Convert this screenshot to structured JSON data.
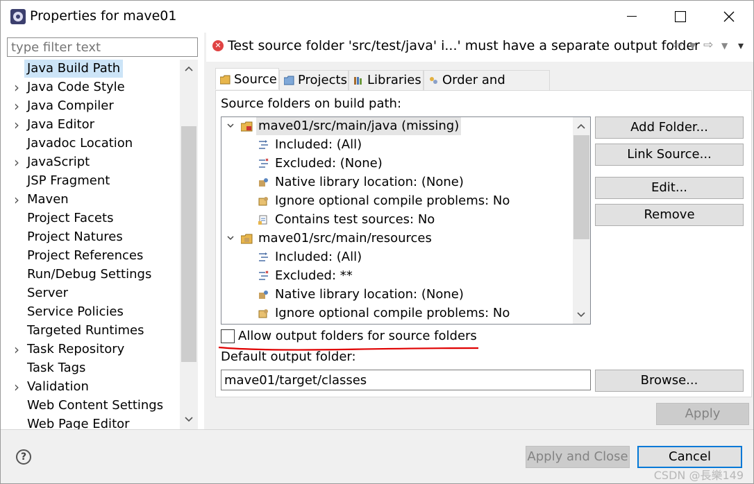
{
  "window": {
    "title": "Properties for mave01",
    "minimize": "—",
    "maximize": "☐",
    "close": "✕"
  },
  "filter": {
    "placeholder": "type filter text"
  },
  "nav": {
    "items": [
      {
        "label": "Java Build Path",
        "expandable": false,
        "selected": true
      },
      {
        "label": "Java Code Style",
        "expandable": true
      },
      {
        "label": "Java Compiler",
        "expandable": true
      },
      {
        "label": "Java Editor",
        "expandable": true
      },
      {
        "label": "Javadoc Location",
        "expandable": false
      },
      {
        "label": "JavaScript",
        "expandable": true
      },
      {
        "label": "JSP Fragment",
        "expandable": false
      },
      {
        "label": "Maven",
        "expandable": true
      },
      {
        "label": "Project Facets",
        "expandable": false
      },
      {
        "label": "Project Natures",
        "expandable": false
      },
      {
        "label": "Project References",
        "expandable": false
      },
      {
        "label": "Run/Debug Settings",
        "expandable": false
      },
      {
        "label": "Server",
        "expandable": false
      },
      {
        "label": "Service Policies",
        "expandable": false
      },
      {
        "label": "Targeted Runtimes",
        "expandable": false
      },
      {
        "label": "Task Repository",
        "expandable": true
      },
      {
        "label": "Task Tags",
        "expandable": false
      },
      {
        "label": "Validation",
        "expandable": true
      },
      {
        "label": "Web Content Settings",
        "expandable": false
      },
      {
        "label": "Web Page Editor",
        "expandable": false
      }
    ]
  },
  "message": {
    "text": "Test source folder 'src/test/java' i...' must have a separate output folder",
    "back_icon": "⇦",
    "forward_icon": "⇨",
    "dropdown_icon": "▼",
    "menu_icon": "▾"
  },
  "tabs": [
    {
      "label": "Source",
      "active": true,
      "icon": "source-folder-icon"
    },
    {
      "label": "Projects",
      "active": false,
      "icon": "projects-icon"
    },
    {
      "label": "Libraries",
      "active": false,
      "icon": "libraries-icon"
    },
    {
      "label": "Order and Export",
      "active": false,
      "icon": "order-export-icon"
    }
  ],
  "source": {
    "heading": "Source folders on build path:",
    "tree": [
      {
        "text": "mave01/src/main/java (missing)",
        "level": 0,
        "expanded": true,
        "selected": true,
        "icon": "missing-package-folder-icon"
      },
      {
        "text": "Included: (All)",
        "level": 1,
        "icon": "inclusion-filter-icon"
      },
      {
        "text": "Excluded: (None)",
        "level": 1,
        "icon": "exclusion-filter-icon"
      },
      {
        "text": "Native library location: (None)",
        "level": 1,
        "icon": "native-library-icon"
      },
      {
        "text": "Ignore optional compile problems: No",
        "level": 1,
        "icon": "ignore-problems-icon"
      },
      {
        "text": "Contains test sources: No",
        "level": 1,
        "icon": "test-sources-icon"
      },
      {
        "text": "mave01/src/main/resources",
        "level": 0,
        "expanded": true,
        "icon": "package-folder-icon"
      },
      {
        "text": "Included: (All)",
        "level": 1,
        "icon": "inclusion-filter-icon"
      },
      {
        "text": "Excluded: **",
        "level": 1,
        "icon": "exclusion-filter-icon"
      },
      {
        "text": "Native library location: (None)",
        "level": 1,
        "icon": "native-library-icon"
      },
      {
        "text": "Ignore optional compile problems: No",
        "level": 1,
        "icon": "ignore-problems-icon"
      }
    ],
    "buttons": {
      "add_folder": "Add Folder...",
      "link_source": "Link Source...",
      "edit": "Edit...",
      "remove": "Remove"
    },
    "allow_output_label": "Allow output folders for source folders",
    "allow_output_checked": false,
    "default_output_label": "Default output folder:",
    "default_output_value": "mave01/target/classes",
    "browse": "Browse..."
  },
  "apply": "Apply",
  "footer": {
    "help": "?",
    "apply_close": "Apply and Close",
    "cancel": "Cancel"
  },
  "watermark": "CSDN @長樂149",
  "colors": {
    "error": "#e04343",
    "selection": "#cce4f7",
    "underline_annotation": "#e00000",
    "focus_border": "#0078d7"
  }
}
